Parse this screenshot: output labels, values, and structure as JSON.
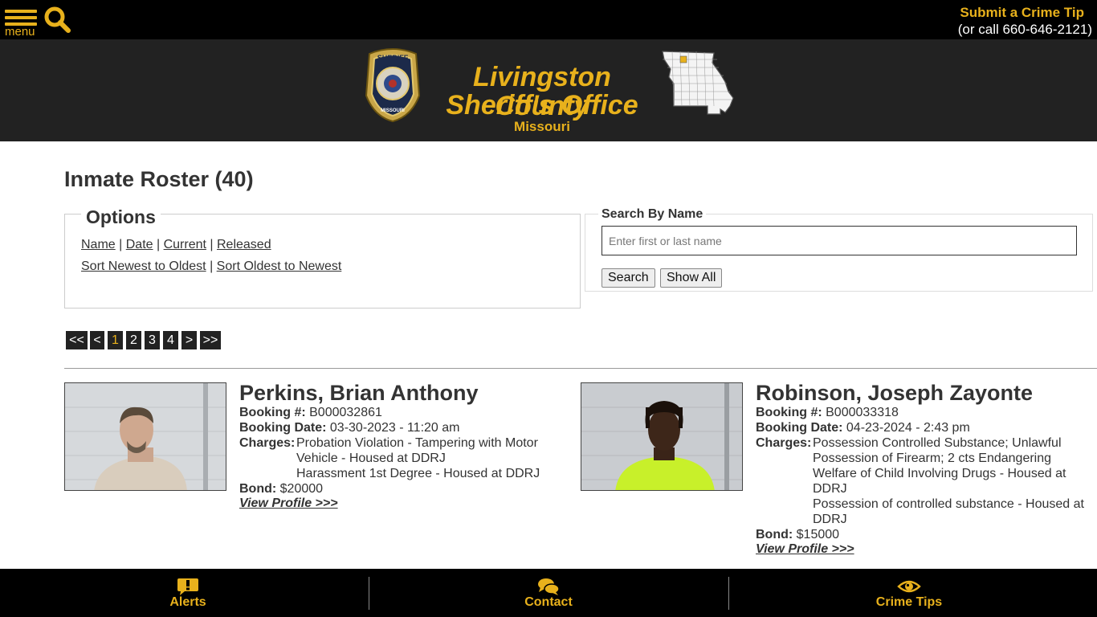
{
  "topbar": {
    "menu_label": "menu",
    "tip_link": "Submit a Crime Tip",
    "tip_call": "(or call 660-646-2121)"
  },
  "header": {
    "title_line1": "Livingston County",
    "title_line2": "Sheriff's Office",
    "state": "Missouri",
    "badge_lines": [
      "SHERIFF",
      "LIVINGSTON CO.",
      "MISSOURI"
    ]
  },
  "page": {
    "title": "Inmate Roster (40)"
  },
  "options": {
    "legend": "Options",
    "filters": [
      "Name",
      "Date",
      "Current",
      "Released"
    ],
    "sorts": [
      "Sort Newest to Oldest",
      "Sort Oldest to Newest"
    ]
  },
  "search": {
    "legend": "Search By Name",
    "placeholder": "Enter first or last name",
    "search_btn": "Search",
    "showall_btn": "Show All"
  },
  "pager": [
    "<<",
    "<",
    "1",
    "2",
    "3",
    "4",
    ">",
    ">>"
  ],
  "inmates": [
    {
      "name": "Perkins, Brian Anthony",
      "booking_label": "Booking #:",
      "booking": "B000032861",
      "date_label": "Booking Date:",
      "date": "03-30-2023 - 11:20 am",
      "charges_label": "Charges:",
      "charges": [
        "Probation Violation - Tampering with Motor Vehicle - Housed at DDRJ",
        "Harassment 1st Degree - Housed at DDRJ"
      ],
      "bond_label": "Bond:",
      "bond": "$20000",
      "view": "View Profile >>>"
    },
    {
      "name": "Robinson, Joseph Zayonte",
      "booking_label": "Booking #:",
      "booking": "B000033318",
      "date_label": "Booking Date:",
      "date": "04-23-2024 - 2:43 pm",
      "charges_label": "Charges:",
      "charges": [
        "Possession Controlled Substance; Unlawful Possession of Firearm; 2 cts Endangering Welfare of Child Involving Drugs - Housed at DDRJ",
        "Possession of controlled substance - Housed at DDRJ"
      ],
      "bond_label": "Bond:",
      "bond": "$15000",
      "view": "View Profile >>>"
    }
  ],
  "footer": {
    "alerts": "Alerts",
    "contact": "Contact",
    "tips": "Crime Tips"
  },
  "colors": {
    "accent": "#e8b11c",
    "topbar": "#000000",
    "header": "#222222"
  }
}
